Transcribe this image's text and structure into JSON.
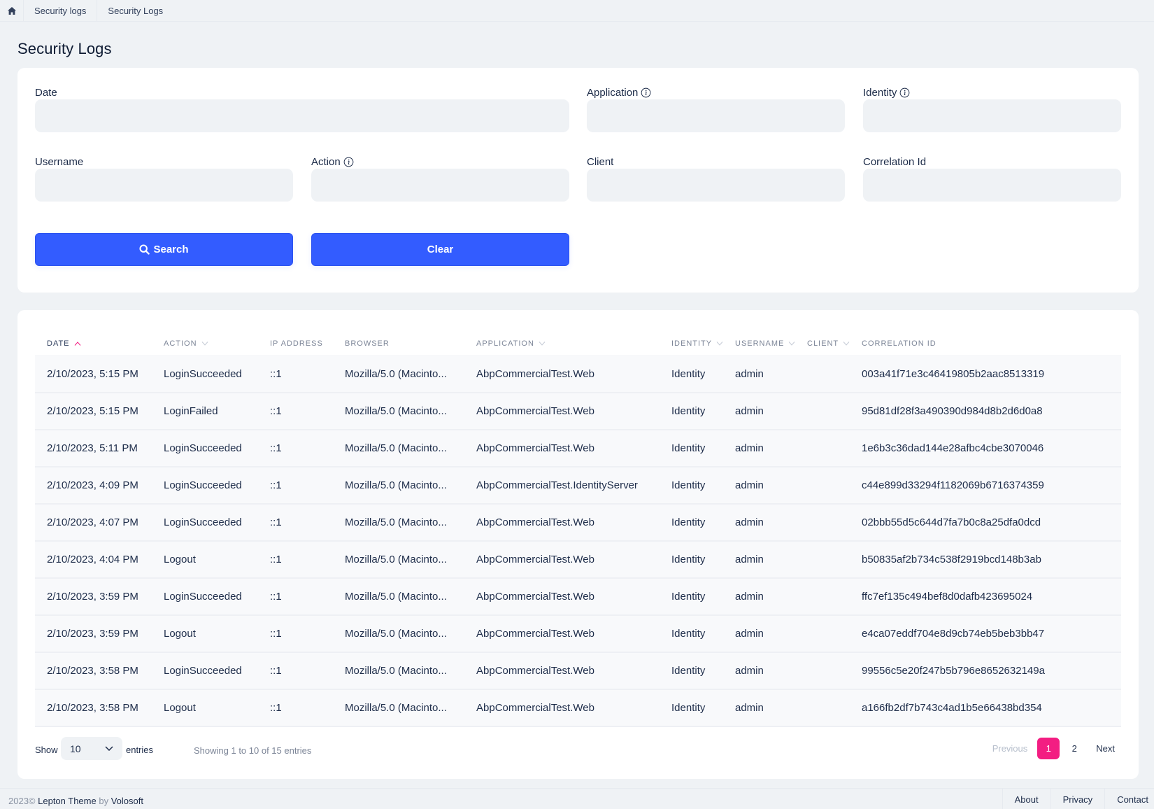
{
  "breadcrumb": {
    "home_icon": "home-icon",
    "items": [
      "Security logs",
      "Security Logs"
    ]
  },
  "page": {
    "title": "Security Logs"
  },
  "filters": {
    "date": {
      "label": "Date",
      "value": ""
    },
    "application": {
      "label": "Application",
      "value": "",
      "info_icon": "info-icon"
    },
    "identity": {
      "label": "Identity",
      "value": "",
      "info_icon": "info-icon"
    },
    "username": {
      "label": "Username",
      "value": ""
    },
    "action": {
      "label": "Action",
      "value": "",
      "info_icon": "info-icon"
    },
    "client": {
      "label": "Client",
      "value": ""
    },
    "correlation_id": {
      "label": "Correlation Id",
      "value": ""
    },
    "search_button": {
      "label": "Search",
      "icon": "search-icon"
    },
    "clear_button": {
      "label": "Clear"
    },
    "button_color": "#335cff"
  },
  "table": {
    "columns": [
      {
        "label": "DATE",
        "sort": "ascending"
      },
      {
        "label": "ACTION",
        "sort": "sortable"
      },
      {
        "label": "IP ADDRESS",
        "sort": "none"
      },
      {
        "label": "BROWSER",
        "sort": "none"
      },
      {
        "label": "APPLICATION",
        "sort": "sortable"
      },
      {
        "label": "IDENTITY",
        "sort": "sortable"
      },
      {
        "label": "USERNAME",
        "sort": "sortable"
      },
      {
        "label": "CLIENT",
        "sort": "sortable"
      },
      {
        "label": "CORRELATION ID",
        "sort": "none"
      }
    ],
    "rows": [
      [
        "2/10/2023, 5:15 PM",
        "LoginSucceeded",
        "::1",
        "Mozilla/5.0 (Macinto...",
        "AbpCommercialTest.Web",
        "Identity",
        "admin",
        "",
        "003a41f71e3c46419805b2aac8513319"
      ],
      [
        "2/10/2023, 5:15 PM",
        "LoginFailed",
        "::1",
        "Mozilla/5.0 (Macinto...",
        "AbpCommercialTest.Web",
        "Identity",
        "admin",
        "",
        "95d81df28f3a490390d984d8b2d6d0a8"
      ],
      [
        "2/10/2023, 5:11 PM",
        "LoginSucceeded",
        "::1",
        "Mozilla/5.0 (Macinto...",
        "AbpCommercialTest.Web",
        "Identity",
        "admin",
        "",
        "1e6b3c36dad144e28afbc4cbe3070046"
      ],
      [
        "2/10/2023, 4:09 PM",
        "LoginSucceeded",
        "::1",
        "Mozilla/5.0 (Macinto...",
        "AbpCommercialTest.IdentityServer",
        "Identity",
        "admin",
        "",
        "c44e899d33294f1182069b6716374359"
      ],
      [
        "2/10/2023, 4:07 PM",
        "LoginSucceeded",
        "::1",
        "Mozilla/5.0 (Macinto...",
        "AbpCommercialTest.Web",
        "Identity",
        "admin",
        "",
        "02bbb55d5c644d7fa7b0c8a25dfa0dcd"
      ],
      [
        "2/10/2023, 4:04 PM",
        "Logout",
        "::1",
        "Mozilla/5.0 (Macinto...",
        "AbpCommercialTest.Web",
        "Identity",
        "admin",
        "",
        "b50835af2b734c538f2919bcd148b3ab"
      ],
      [
        "2/10/2023, 3:59 PM",
        "LoginSucceeded",
        "::1",
        "Mozilla/5.0 (Macinto...",
        "AbpCommercialTest.Web",
        "Identity",
        "admin",
        "",
        "ffc7ef135c494bef8d0dafb423695024"
      ],
      [
        "2/10/2023, 3:59 PM",
        "Logout",
        "::1",
        "Mozilla/5.0 (Macinto...",
        "AbpCommercialTest.Web",
        "Identity",
        "admin",
        "",
        "e4ca07eddf704e8d9cb74eb5beb3bb47"
      ],
      [
        "2/10/2023, 3:58 PM",
        "LoginSucceeded",
        "::1",
        "Mozilla/5.0 (Macinto...",
        "AbpCommercialTest.Web",
        "Identity",
        "admin",
        "",
        "99556c5e20f247b5b796e8652632149a"
      ],
      [
        "2/10/2023, 3:58 PM",
        "Logout",
        "::1",
        "Mozilla/5.0 (Macinto...",
        "AbpCommercialTest.Web",
        "Identity",
        "admin",
        "",
        "a166fb2df7b743c4ad1b5e66438bd354"
      ]
    ],
    "length_menu": {
      "show_label": "Show",
      "selected": "10",
      "entries_label": "entries"
    },
    "info": "Showing 1 to 10 of 15 entries",
    "pagination": {
      "previous": "Previous",
      "pages": [
        "1",
        "2"
      ],
      "current_page": "1",
      "next": "Next",
      "active_color": "#f31d82"
    }
  },
  "footer": {
    "year": "2023©",
    "theme": "Lepton Theme",
    "by": "by",
    "company": "Volosoft",
    "links": [
      "About",
      "Privacy",
      "Contact"
    ]
  }
}
